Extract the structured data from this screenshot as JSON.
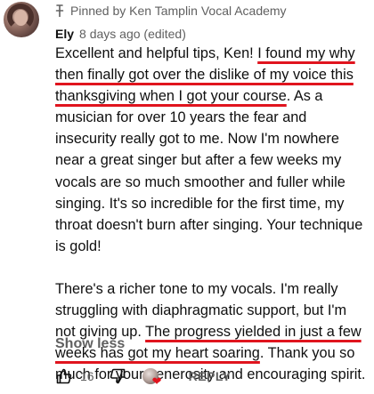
{
  "pinned": {
    "text": "Pinned by Ken Tamplin Vocal Academy",
    "icon": "pin-icon"
  },
  "comment": {
    "author": "Ely",
    "meta": "8 days ago (edited)",
    "p1_a": "Excellent and helpful tips, Ken! ",
    "p1_b": "I found my why then finally got over the dislike of my voice this thanksgiving when I got your course",
    "p1_c": ". As a musician for over 10 years the fear and insecurity really got to me. Now I'm nowhere near a great singer but after a few weeks my vocals are so much smoother and fuller while singing. It's so incredible for the first time, my throat doesn't burn after singing. Your technique is gold!",
    "p2_a": "There's a richer tone to my vocals. I'm really struggling with diaphragmatic support, but I'm not giving up. ",
    "p2_b": "The progress yielded in just a few weeks has got my heart soaring",
    "p2_c": ". Thank you so much for your generosity and encouraging spirit.",
    "underline_color": "#e0141e"
  },
  "show_less": "Show less",
  "actions": {
    "like_icon": "thumbs-up-icon",
    "like_count": "16",
    "dislike_icon": "thumbs-down-icon",
    "creator_heart_icon": "creator-heart-icon",
    "reply_label": "REPLY"
  }
}
